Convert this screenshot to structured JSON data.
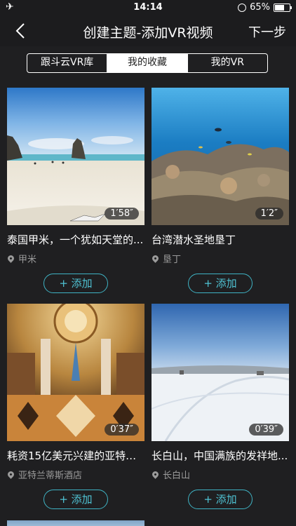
{
  "status_bar": {
    "time": "14:14",
    "battery": "65%",
    "battery_level": 0.65
  },
  "nav": {
    "title": "创建主题-添加VR视频",
    "next_label": "下一步"
  },
  "tabs": [
    {
      "label": "跟斗云VR库",
      "active": false
    },
    {
      "label": "我的收藏",
      "active": true
    },
    {
      "label": "我的VR",
      "active": false
    }
  ],
  "videos": [
    {
      "title": "泰国甲米，一个犹如天堂的...",
      "location": "甲米",
      "duration": "1′58″",
      "add_label": "+ 添加"
    },
    {
      "title": "台湾潜水圣地垦丁",
      "location": "垦丁",
      "duration": "1′2″",
      "add_label": "+ 添加"
    },
    {
      "title": "耗资15亿美元兴建的亚特兰...",
      "location": "亚特兰蒂斯酒店",
      "duration": "0′37″",
      "add_label": "+ 添加"
    },
    {
      "title": "长白山，中国满族的发祥地...",
      "location": "长白山",
      "duration": "0′39″",
      "add_label": "+ 添加"
    }
  ],
  "colors": {
    "background": "#1f1f21",
    "accent": "#4fc3d4",
    "muted_text": "#9b9b9b"
  }
}
